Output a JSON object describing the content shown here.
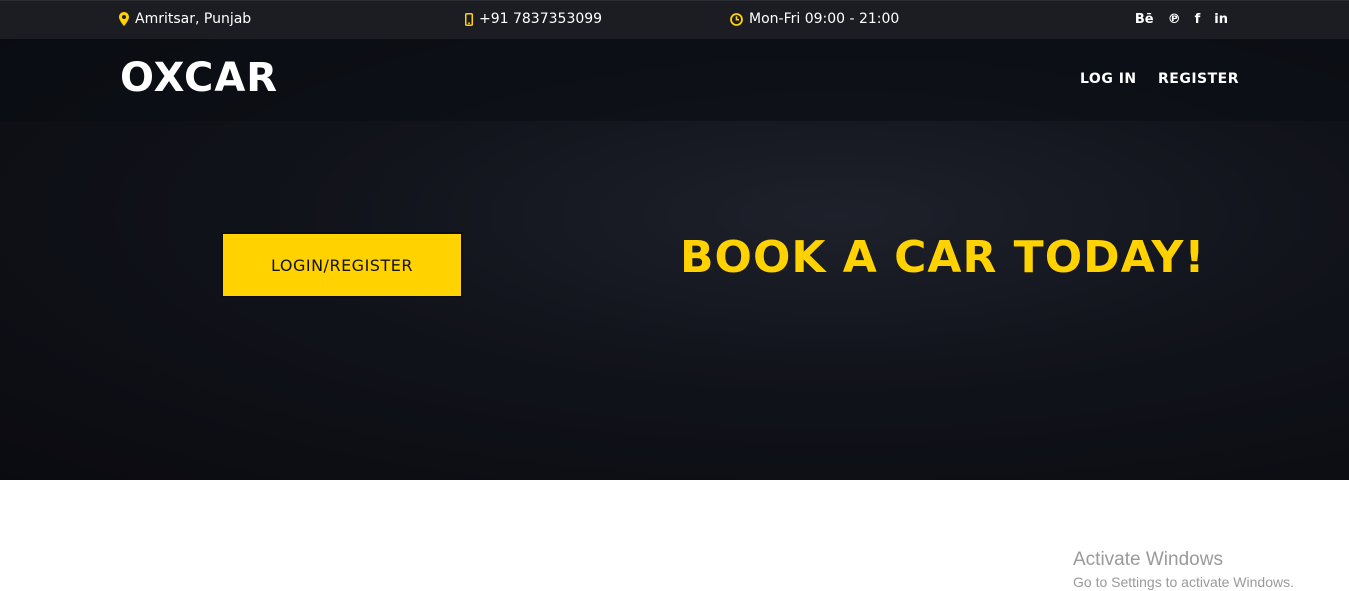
{
  "topbar": {
    "location": "Amritsar, Punjab",
    "phone": "+91 7837353099",
    "hours": "Mon-Fri 09:00 - 21:00",
    "socials": [
      {
        "icon": "behance-icon",
        "label": "Bē"
      },
      {
        "icon": "pinterest-icon",
        "label": "℗"
      },
      {
        "icon": "facebook-icon",
        "label": "f"
      },
      {
        "icon": "linkedin-icon",
        "label": "in"
      }
    ]
  },
  "header": {
    "logo": "OXCAR",
    "nav": {
      "login": "LOG IN",
      "register": "REGISTER"
    }
  },
  "hero": {
    "cta_label": "LOGIN/REGISTER",
    "headline": "BOOK A CAR TODAY!"
  },
  "watermark": {
    "title": "Activate Windows",
    "subtitle": "Go to Settings to activate Windows."
  },
  "colors": {
    "accent": "#ffd200",
    "topbar_bg": "#1c1d22",
    "hero_bg": "#161922"
  }
}
